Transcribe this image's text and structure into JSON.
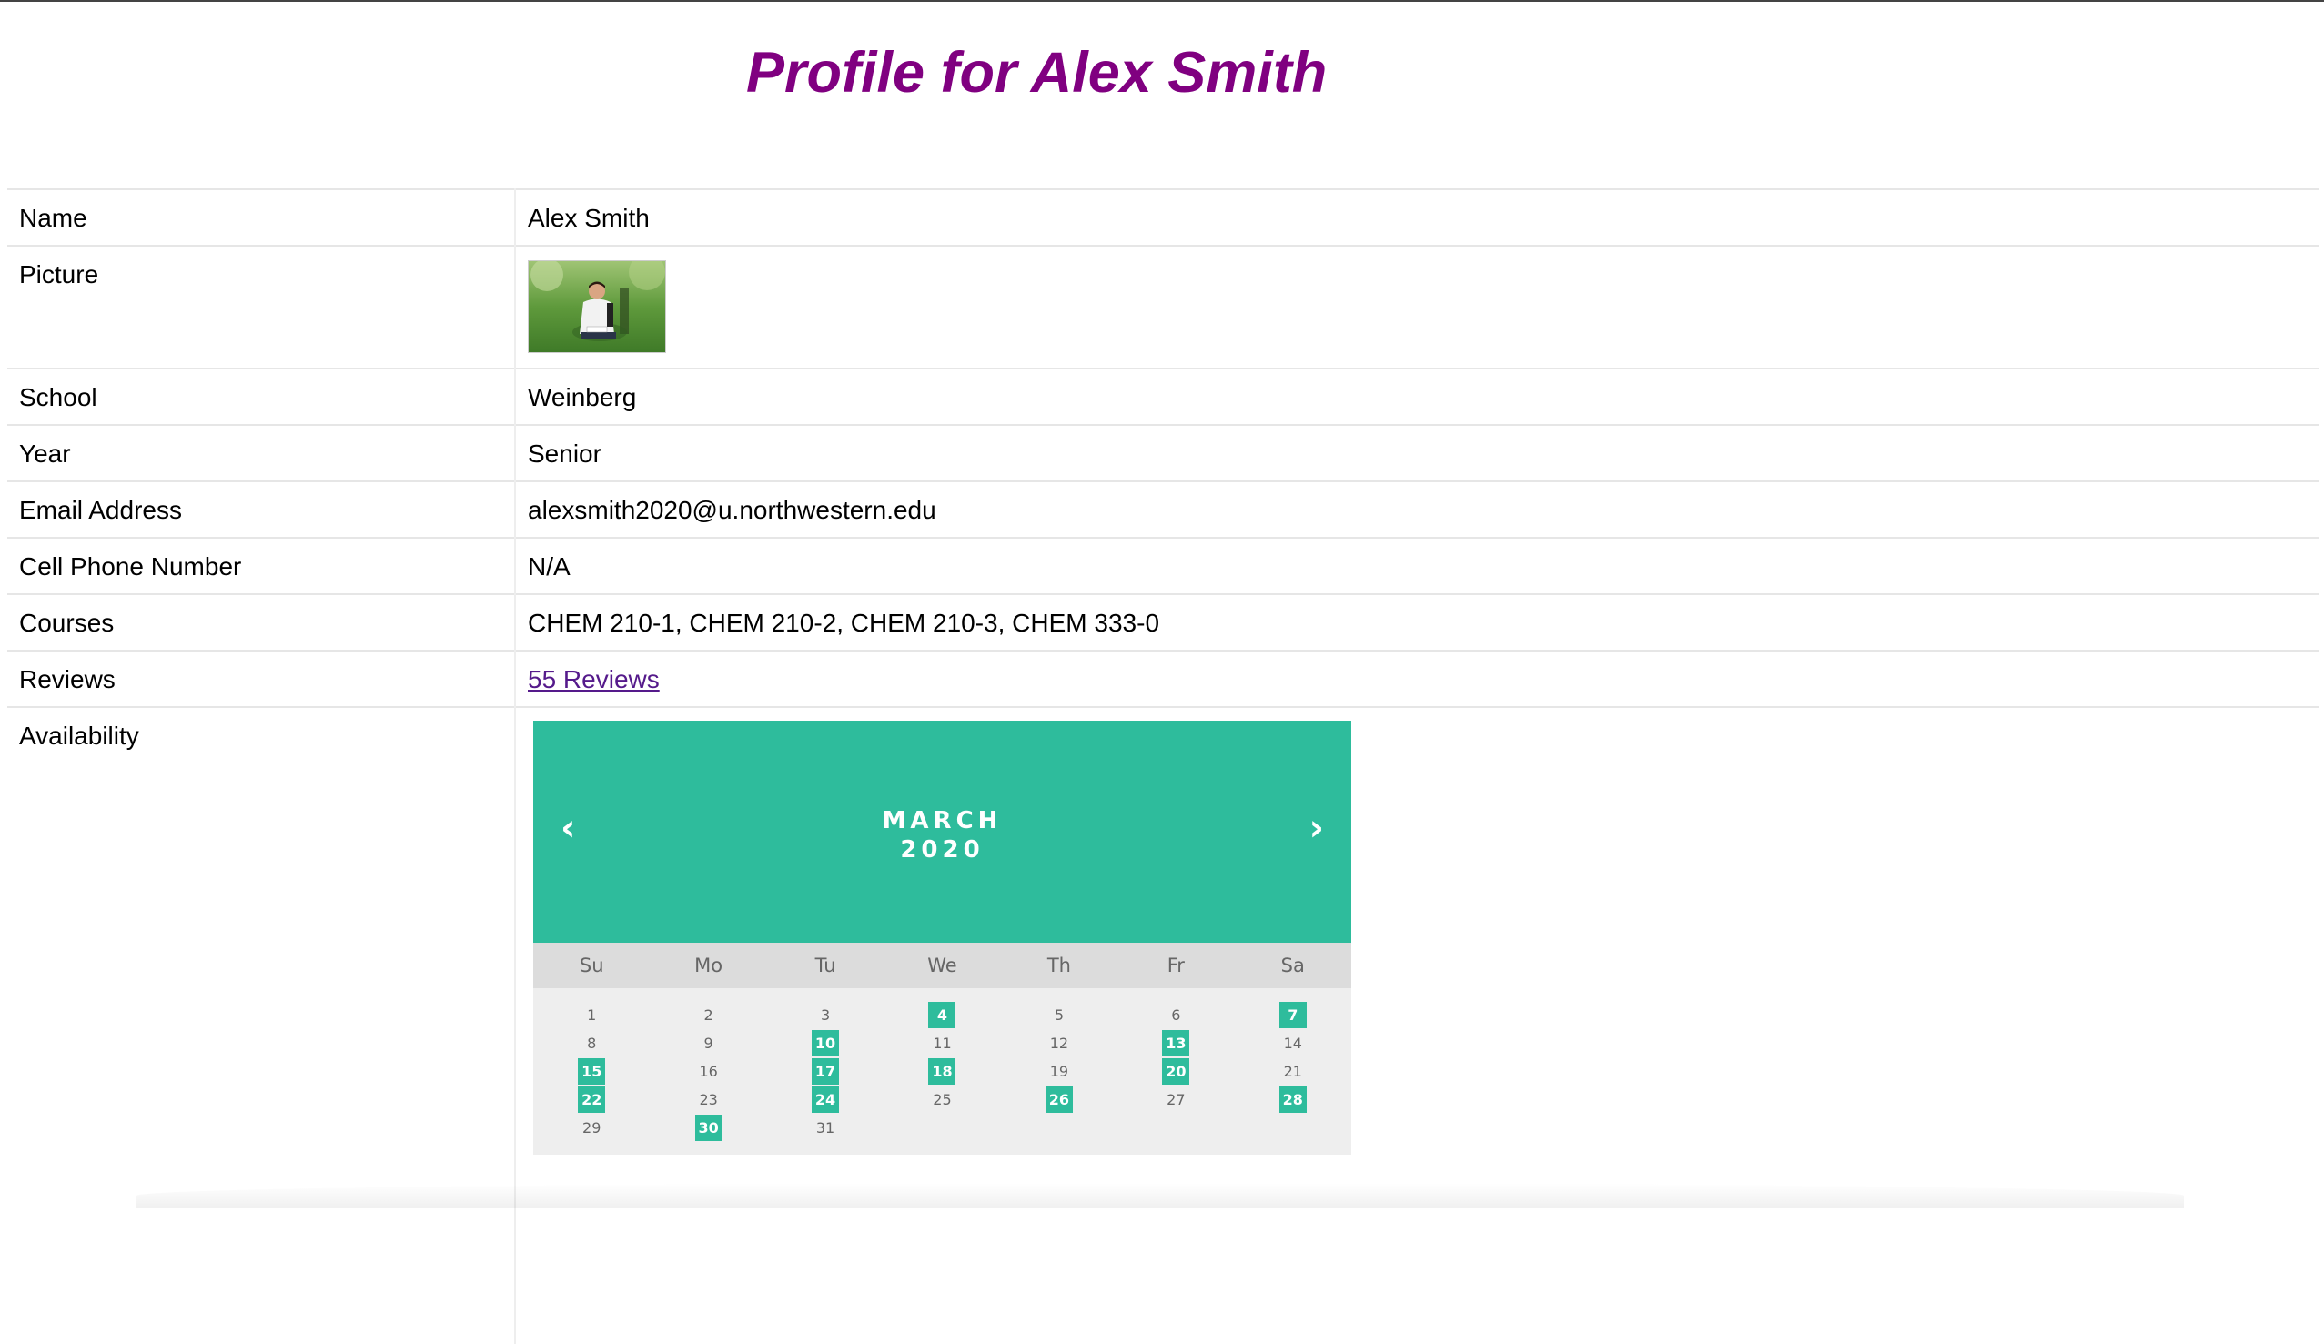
{
  "page": {
    "title": "Profile for Alex Smith"
  },
  "profile": {
    "rows": {
      "name": {
        "label": "Name",
        "value": "Alex Smith"
      },
      "picture": {
        "label": "Picture",
        "alt": "Alex Smith"
      },
      "school": {
        "label": "School",
        "value": "Weinberg"
      },
      "year": {
        "label": "Year",
        "value": "Senior"
      },
      "email": {
        "label": "Email Address",
        "value": "alexsmith2020@u.northwestern.edu"
      },
      "phone": {
        "label": "Cell Phone Number",
        "value": "N/A"
      },
      "courses": {
        "label": "Courses",
        "value": "CHEM 210-1, CHEM 210-2, CHEM 210-3, CHEM 333-0"
      },
      "reviews": {
        "label": "Reviews",
        "link_text": "55 Reviews"
      },
      "availability": {
        "label": "Availability"
      }
    }
  },
  "calendar": {
    "month": "MARCH",
    "year": "2020",
    "prev_glyph": "‹",
    "next_glyph": "›",
    "weekdays": [
      "Su",
      "Mo",
      "Tu",
      "We",
      "Th",
      "Fr",
      "Sa"
    ],
    "first_weekday_offset": 0,
    "days_in_month": 31,
    "available_days": [
      4,
      7,
      10,
      13,
      15,
      17,
      18,
      20,
      22,
      24,
      26,
      28,
      30
    ],
    "colors": {
      "accent": "#2ebc9c",
      "body_bg": "#eeeeee",
      "weekday_bar": "#dcdcdc"
    }
  },
  "colors": {
    "title": "#800080",
    "link": "#551a8b"
  }
}
